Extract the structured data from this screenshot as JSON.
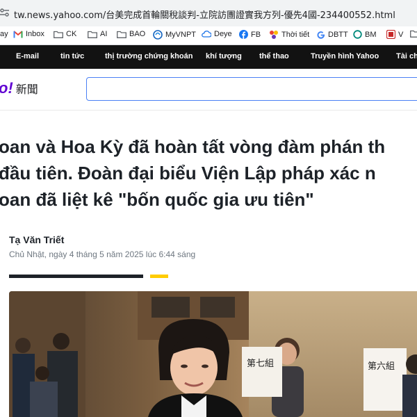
{
  "browser": {
    "url": "tw.news.yahoo.com/台美完成首輪關稅談判-立院訪團證實我方列-優先4國-234400552.html"
  },
  "bookmarks": [
    {
      "label": "ay",
      "icon": "none"
    },
    {
      "label": "Inbox",
      "icon": "gmail-icon"
    },
    {
      "label": "CK",
      "icon": "folder-icon"
    },
    {
      "label": "AI",
      "icon": "folder-icon"
    },
    {
      "label": "BAO",
      "icon": "folder-icon"
    },
    {
      "label": "MyVNPT",
      "icon": "vnpt-icon"
    },
    {
      "label": "Deye",
      "icon": "cloud-icon"
    },
    {
      "label": "FB",
      "icon": "facebook-icon"
    },
    {
      "label": "Thời tiết",
      "icon": "weather-icon"
    },
    {
      "label": "DBTT",
      "icon": "google-icon"
    },
    {
      "label": "BM",
      "icon": "circle-icon"
    },
    {
      "label": "V",
      "icon": "v-icon"
    }
  ],
  "nav": {
    "items": [
      "E-mail",
      "tin tức",
      "thị trường chứng khoán",
      "khí tượng",
      "thể thao",
      "Truyền hình Yahoo",
      "Tài ch"
    ]
  },
  "logo": {
    "text": "o!",
    "suffix": "新聞"
  },
  "search": {
    "value": ""
  },
  "article": {
    "headline_lines": [
      "oan và Hoa Kỳ đã hoàn tất vòng đàm phán th",
      " đầu tiên. Đoàn đại biểu Viện Lập pháp xác n",
      "oan đã liệt kê \"bốn quốc gia ưu tiên\""
    ],
    "author": "Tạ Văn Triết",
    "date": "Chủ Nhật, ngày 4 tháng 5 năm 2025 lúc 6:44 sáng"
  },
  "photo": {
    "sign_text": [
      "第七組",
      "第六組"
    ]
  },
  "colors": {
    "nav_bg": "#121212",
    "yahoo_purple": "#6001d2",
    "accent_yellow": "#ffcc00",
    "search_border": "#4a80f5"
  }
}
